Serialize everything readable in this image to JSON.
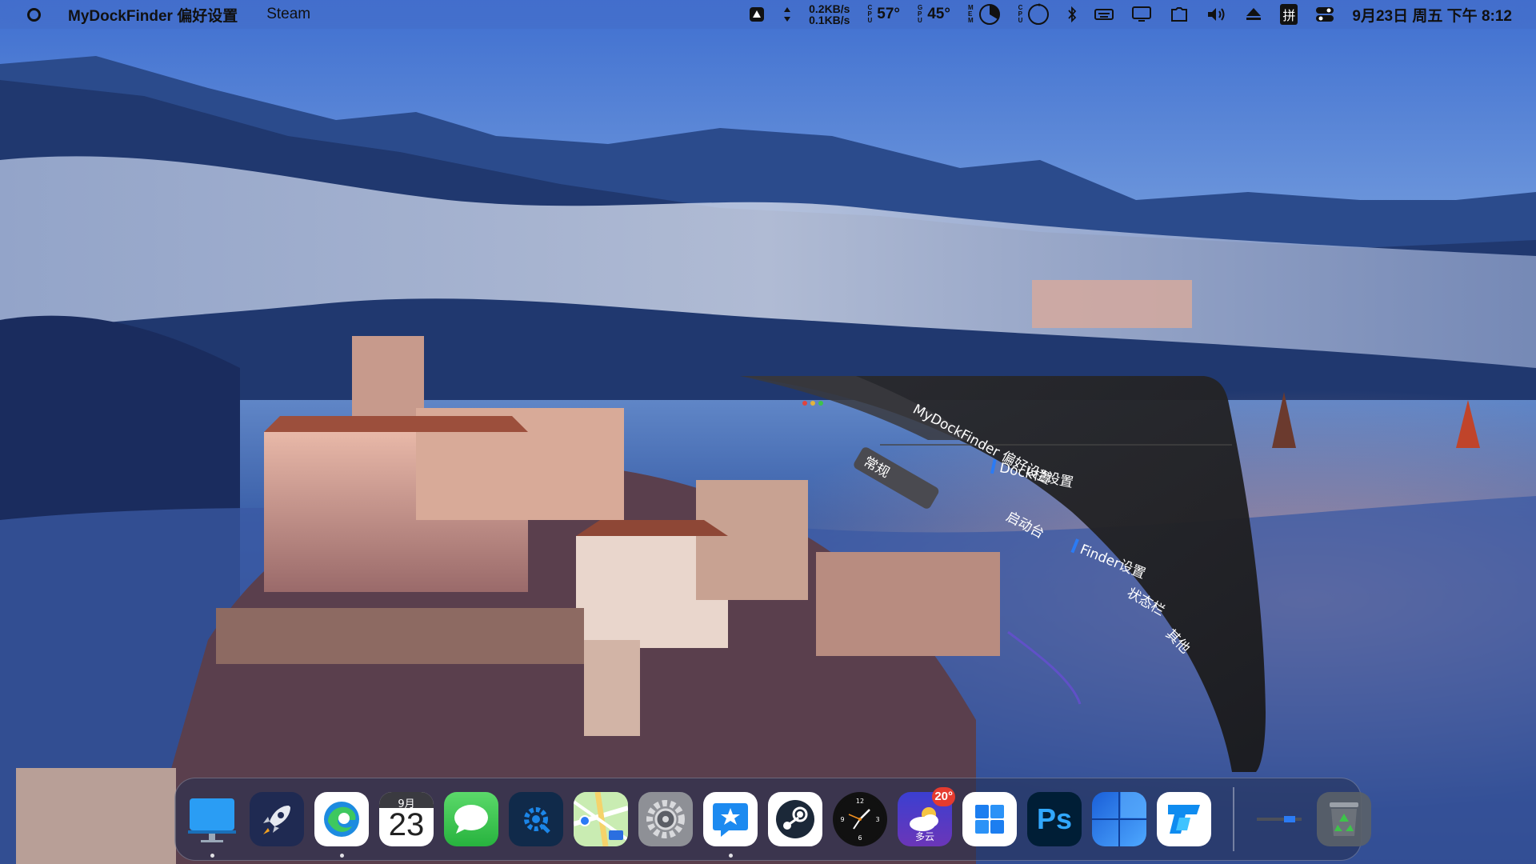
{
  "menubar": {
    "app_name": "MyDockFinder 偏好设置",
    "menus": [
      "Steam"
    ],
    "network": {
      "up": "0.2KB/s",
      "down": "0.1KB/s"
    },
    "cpu_label": [
      "C",
      "P",
      "U"
    ],
    "cpu_temp": "57°",
    "gpu_label": [
      "G",
      "P",
      "U"
    ],
    "gpu_temp": "45°",
    "mem_label": [
      "M",
      "E",
      "M"
    ],
    "cpu2_label": [
      "C",
      "P",
      "U"
    ],
    "ime_label": "拼",
    "datetime": "9月23日 周五 下午 8:12"
  },
  "panel": {
    "title": "MyDockFinder 偏好设置",
    "items": [
      "常规",
      "Dock栏设置",
      "启动台",
      "Finder设置",
      "状态栏",
      "其他"
    ]
  },
  "dock": {
    "calendar": {
      "month": "9月",
      "day": "23"
    },
    "weather": {
      "temp_badge": "20°",
      "label": "多云"
    },
    "photoshop_label": "Ps",
    "apps": [
      {
        "name": "finder",
        "running": true
      },
      {
        "name": "launchpad",
        "running": false
      },
      {
        "name": "edge",
        "running": true
      },
      {
        "name": "calendar",
        "running": false
      },
      {
        "name": "messages",
        "running": false
      },
      {
        "name": "settings-gear-app",
        "running": false
      },
      {
        "name": "maps",
        "running": false
      },
      {
        "name": "system-preferences",
        "running": false
      },
      {
        "name": "mydockfinder",
        "running": true
      },
      {
        "name": "steam",
        "running": false
      },
      {
        "name": "clock",
        "running": false
      },
      {
        "name": "weather",
        "running": false
      },
      {
        "name": "windows-start",
        "running": false
      },
      {
        "name": "photoshop",
        "running": false
      },
      {
        "name": "windows-widget",
        "running": false
      },
      {
        "name": "todesk",
        "running": false
      }
    ]
  },
  "colors": {
    "menubar_bg": "#466ec8",
    "dock_bg": "#232d50",
    "badge_red": "#e53b2f",
    "ps_blue": "#31a8ff"
  }
}
